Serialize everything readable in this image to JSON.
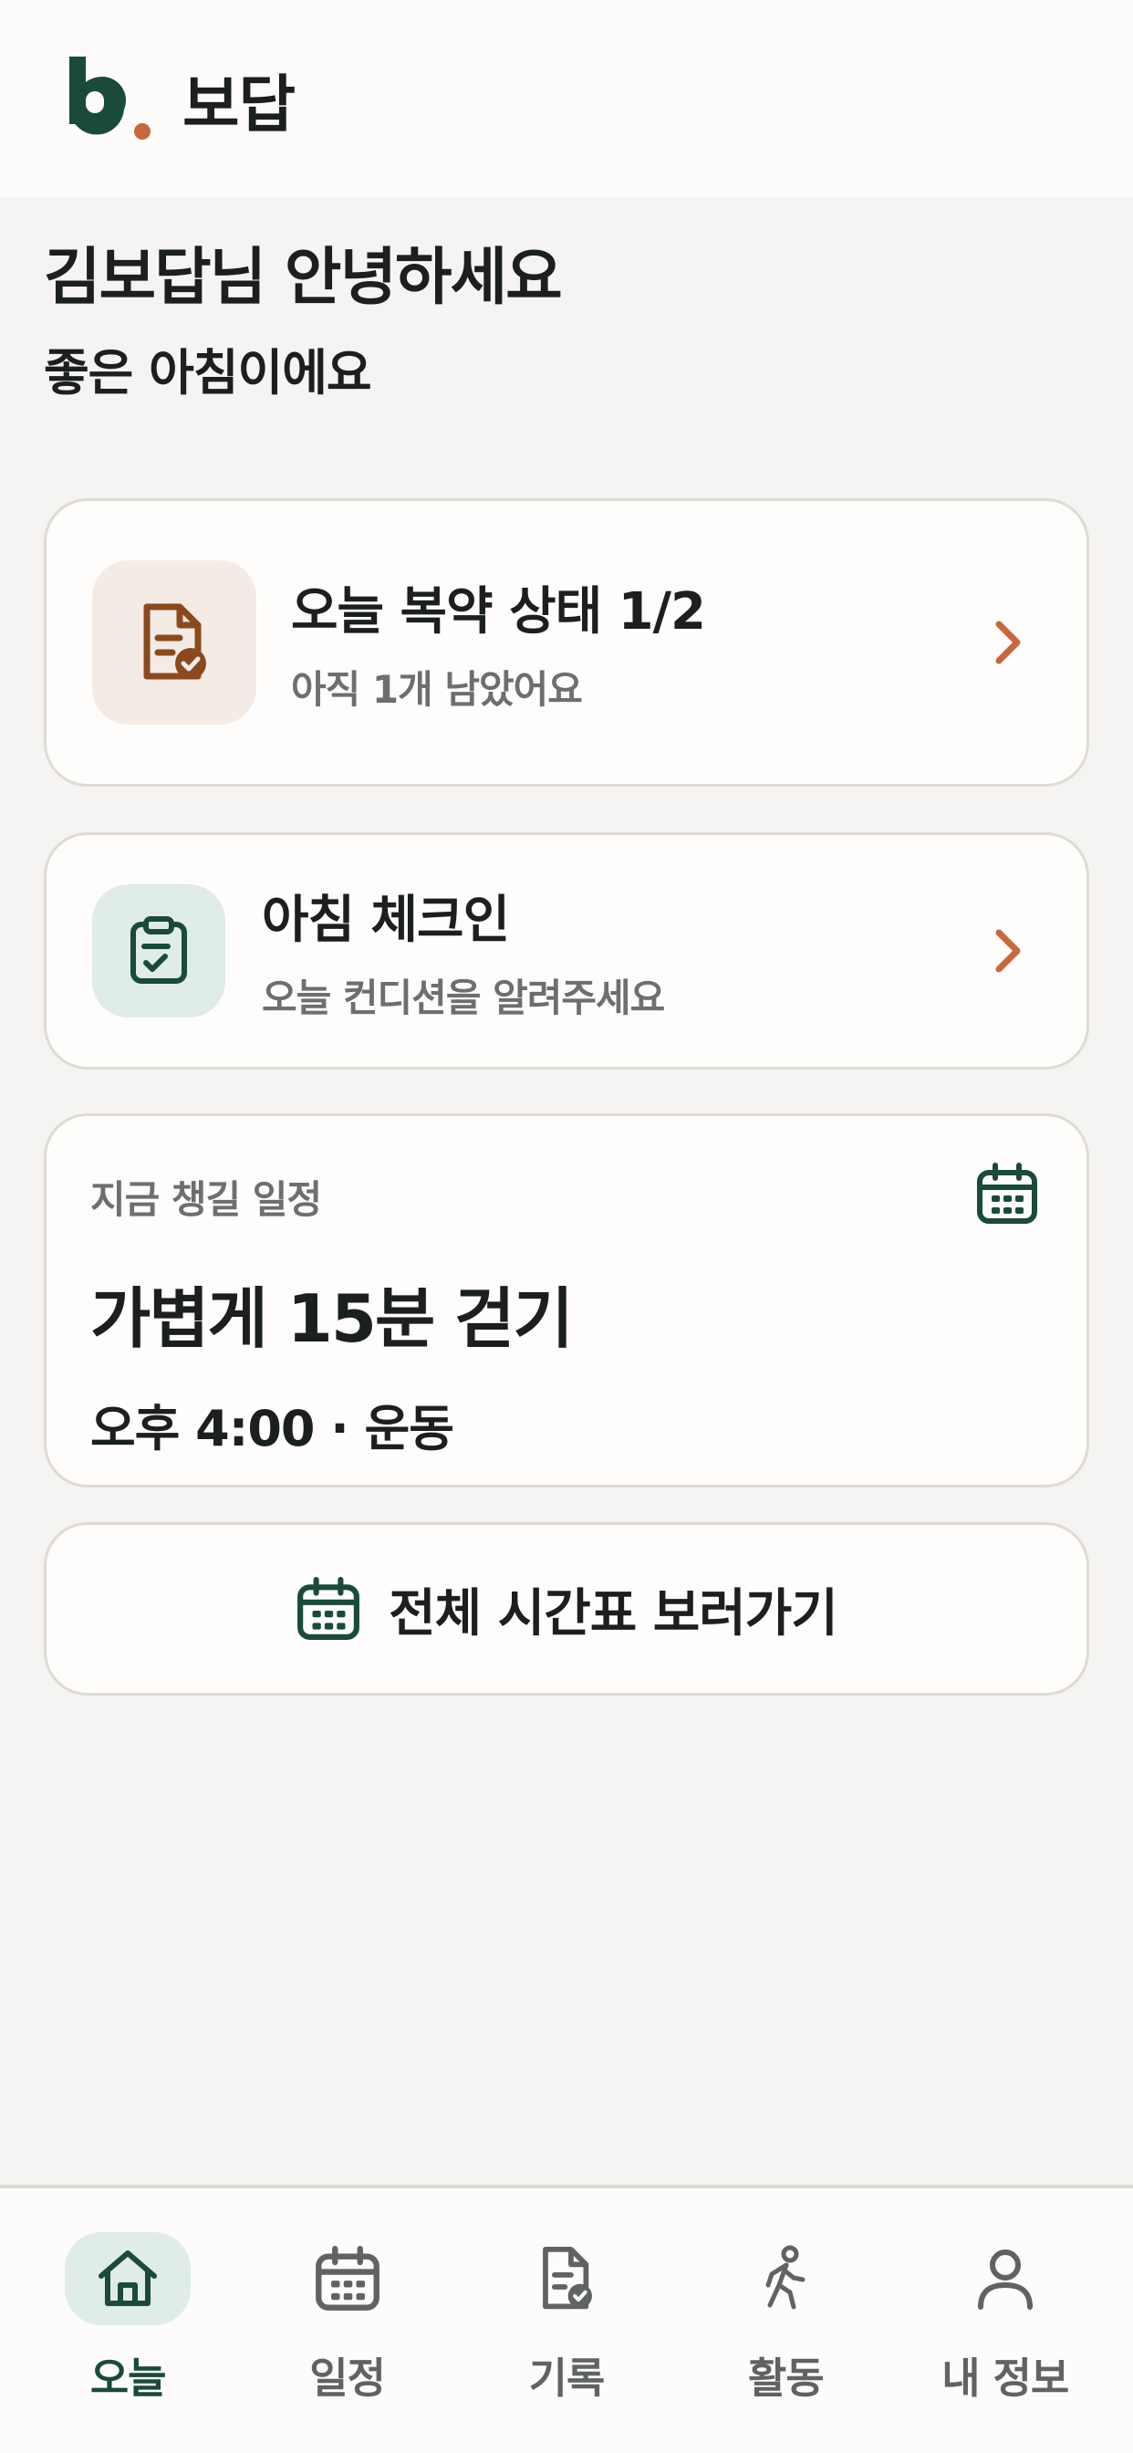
{
  "colors": {
    "brand_green": "#1a4a3c",
    "accent_orange": "#c7683f",
    "med_icon_brown": "#8a4a1e",
    "background": "#f5f4f2",
    "card": "#fefdfb"
  },
  "header": {
    "logo_icon": "brand-b-logo",
    "title": "보답"
  },
  "greeting": {
    "title": "김보답님 안녕하세요",
    "subtitle": "좋은 아침이에요"
  },
  "medication_card": {
    "icon": "document-check-icon",
    "title": "오늘 복약 상태 1/2",
    "subtitle": "아직 1개 남았어요"
  },
  "checkin_card": {
    "icon": "clipboard-check-icon",
    "title": "아침 체크인",
    "subtitle": "오늘 컨디션을 알려주세요"
  },
  "schedule_card": {
    "label": "지금 챙길 일정",
    "icon": "calendar-icon",
    "title": "가볍게 15분 걷기",
    "time": "오후 4:00 · 운동"
  },
  "timetable_button": {
    "icon": "calendar-icon",
    "label": "전체 시간표 보러가기"
  },
  "bottom_nav": {
    "items": [
      {
        "label": "오늘",
        "icon": "home-icon",
        "active": true
      },
      {
        "label": "일정",
        "icon": "calendar-icon",
        "active": false
      },
      {
        "label": "기록",
        "icon": "document-check-icon",
        "active": false
      },
      {
        "label": "활동",
        "icon": "walking-icon",
        "active": false
      },
      {
        "label": "내 정보",
        "icon": "user-icon",
        "active": false
      }
    ]
  }
}
